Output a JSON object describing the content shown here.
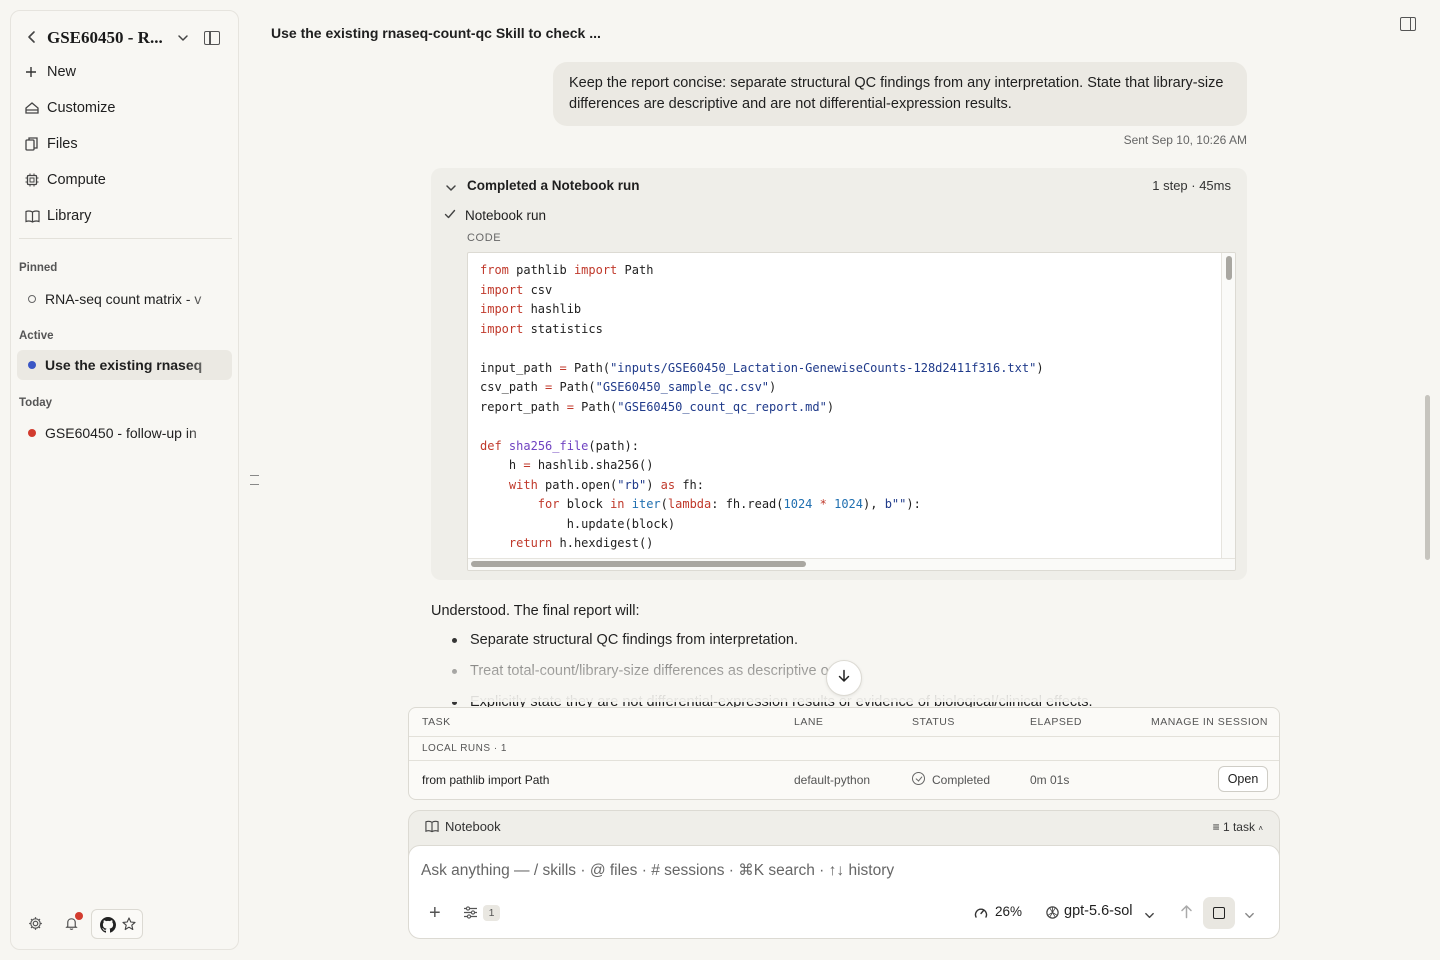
{
  "sidebar": {
    "project_title": "GSE60450 - R...",
    "nav": [
      {
        "label": "New",
        "icon": "plus-icon"
      },
      {
        "label": "Customize",
        "icon": "customize-icon"
      },
      {
        "label": "Files",
        "icon": "files-icon"
      },
      {
        "label": "Compute",
        "icon": "chip-icon"
      },
      {
        "label": "Library",
        "icon": "book-icon"
      }
    ],
    "sections": {
      "pinned": "Pinned",
      "active": "Active",
      "today": "Today"
    },
    "sessions": {
      "pinned": "RNA-seq count matrix - v",
      "active": "Use the existing rnaseq",
      "today": "GSE60450 - follow-up in"
    },
    "colors": {
      "active_dot": "#3a56c5",
      "today_dot": "#d23b2e",
      "pinned_dot": "hollow"
    }
  },
  "header": {
    "title": "Use the existing rnaseq-count-qc Skill to check ..."
  },
  "chat": {
    "user_message": "Keep the report concise: separate structural QC findings from any interpretation. State that library-size differences are descriptive and are not differential-expression results.",
    "sent_time": "Sent Sep 10, 10:26 AM",
    "run": {
      "title": "Completed a Notebook run",
      "meta": "1 step · 45ms",
      "step_label": "Notebook run",
      "code_label": "CODE"
    },
    "reply": {
      "intro": "Understood. The final report will:",
      "bullets": [
        "Separate structural QC findings from interpretation.",
        "Treat total-count/library-size differences as descriptive only.",
        "Explicitly state they are not differential-expression results or evidence of biological/clinical effects."
      ]
    }
  },
  "tasks": {
    "headers": {
      "task": "TASK",
      "lane": "LANE",
      "status": "STATUS",
      "elapsed": "ELAPSED",
      "manage": "MANAGE IN SESSION"
    },
    "group": "LOCAL RUNS · 1",
    "row": {
      "task": "from pathlib import Path",
      "lane": "default-python",
      "status": "Completed",
      "elapsed": "0m 01s",
      "action": "Open"
    }
  },
  "composer": {
    "mode": "Notebook",
    "task_count": "1 task",
    "placeholder": "Ask anything — / skills · @ files · # sessions · ⌘K search · ↑↓ history",
    "tools_count": "1",
    "context_usage": "26%",
    "model": "gpt-5.6-sol"
  }
}
